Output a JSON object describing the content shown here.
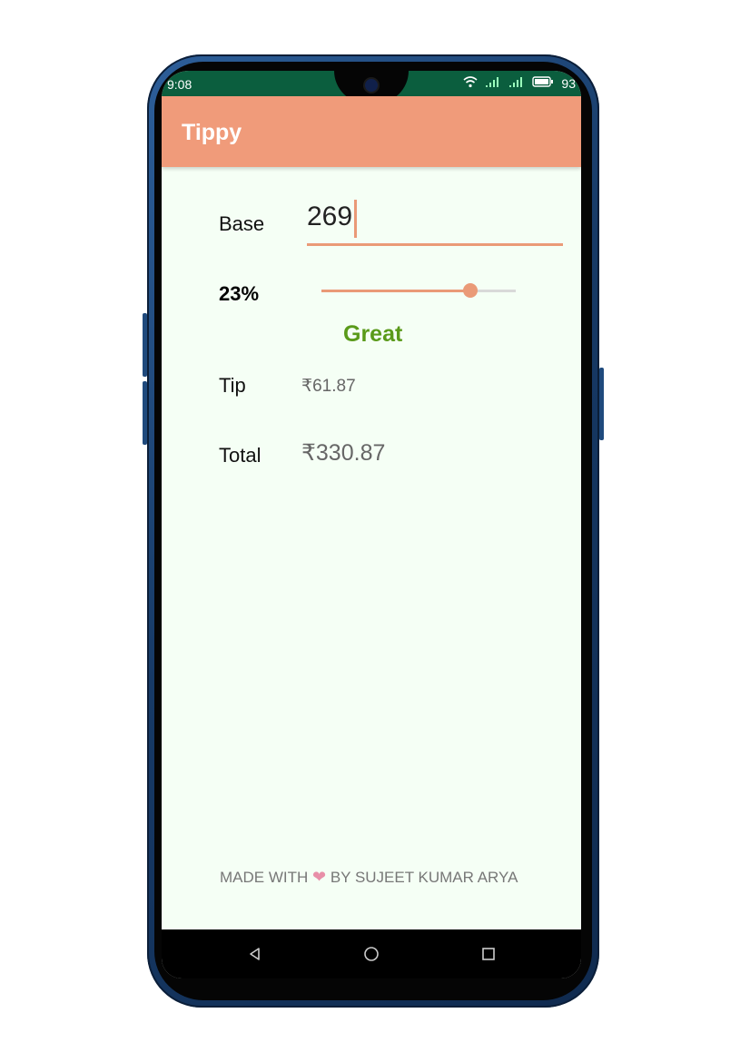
{
  "status_bar": {
    "time": "9:08",
    "battery": "93"
  },
  "app": {
    "title": "Tippy"
  },
  "form": {
    "base_label": "Base",
    "base_value": "269",
    "tip_percent_label": "23%",
    "tip_percent": 23,
    "slider_max": 30,
    "tip_description": "Great",
    "tip_label": "Tip",
    "tip_amount": "₹61.87",
    "total_label": "Total",
    "total_amount": "₹330.87"
  },
  "footer": {
    "made_with": "MADE WITH",
    "by_text": "BY SUJEET KUMAR ARYA"
  },
  "colors": {
    "primary": "#f09b7a",
    "accent": "#ea9a77",
    "status_bar": "#0b5e3e",
    "description": "#5a9a1a",
    "background": "#f5fff5"
  },
  "icons": {
    "wifi": "wifi-icon",
    "signal": "signal-icon",
    "battery": "battery-icon",
    "heart": "heart-icon",
    "back": "back-icon",
    "home": "home-icon",
    "recents": "recents-icon"
  }
}
